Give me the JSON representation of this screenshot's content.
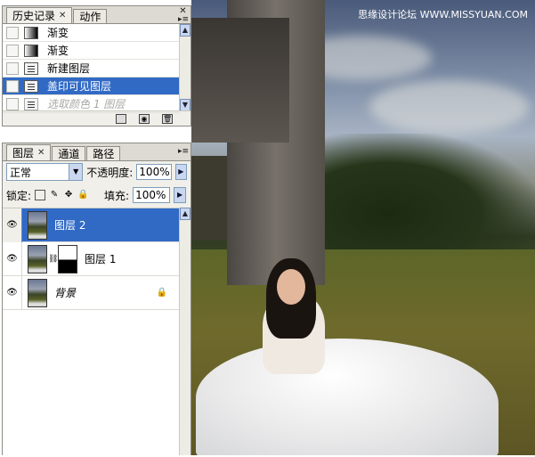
{
  "watermark": "思缘设计论坛 WWW.MISSYUAN.COM",
  "history_panel": {
    "tabs": [
      {
        "label": "历史记录",
        "active": true
      },
      {
        "label": "动作",
        "active": false
      }
    ],
    "items": [
      {
        "label": "渐变",
        "icon": "gradient-icon"
      },
      {
        "label": "渐变",
        "icon": "gradient-icon"
      },
      {
        "label": "新建图层",
        "icon": "new-layer-doc-icon"
      },
      {
        "label": "盖印可见图层",
        "icon": "stamp-visible-doc-icon",
        "selected": true
      },
      {
        "label": "选取颜色 1 图层",
        "icon": "selective-color-doc-icon",
        "faded": true
      }
    ],
    "footer_icons": [
      "new-document-from-state-icon",
      "new-snapshot-icon",
      "delete-state-icon"
    ]
  },
  "layers_panel": {
    "tabs": [
      {
        "label": "图层",
        "active": true
      },
      {
        "label": "通道",
        "active": false
      },
      {
        "label": "路径",
        "active": false
      }
    ],
    "blend_mode": "正常",
    "opacity_label": "不透明度:",
    "opacity_value": "100%",
    "lock_label": "锁定:",
    "fill_label": "填充:",
    "fill_value": "100%",
    "layers": [
      {
        "name": "图层 2",
        "selected": true,
        "visible": true
      },
      {
        "name": "图层 1",
        "selected": false,
        "visible": true,
        "has_mask": true
      },
      {
        "name": "背景",
        "selected": false,
        "visible": true,
        "locked": true
      }
    ]
  },
  "colors": {
    "selection": "#316ac5",
    "panel_bg": "#f0efe9"
  }
}
